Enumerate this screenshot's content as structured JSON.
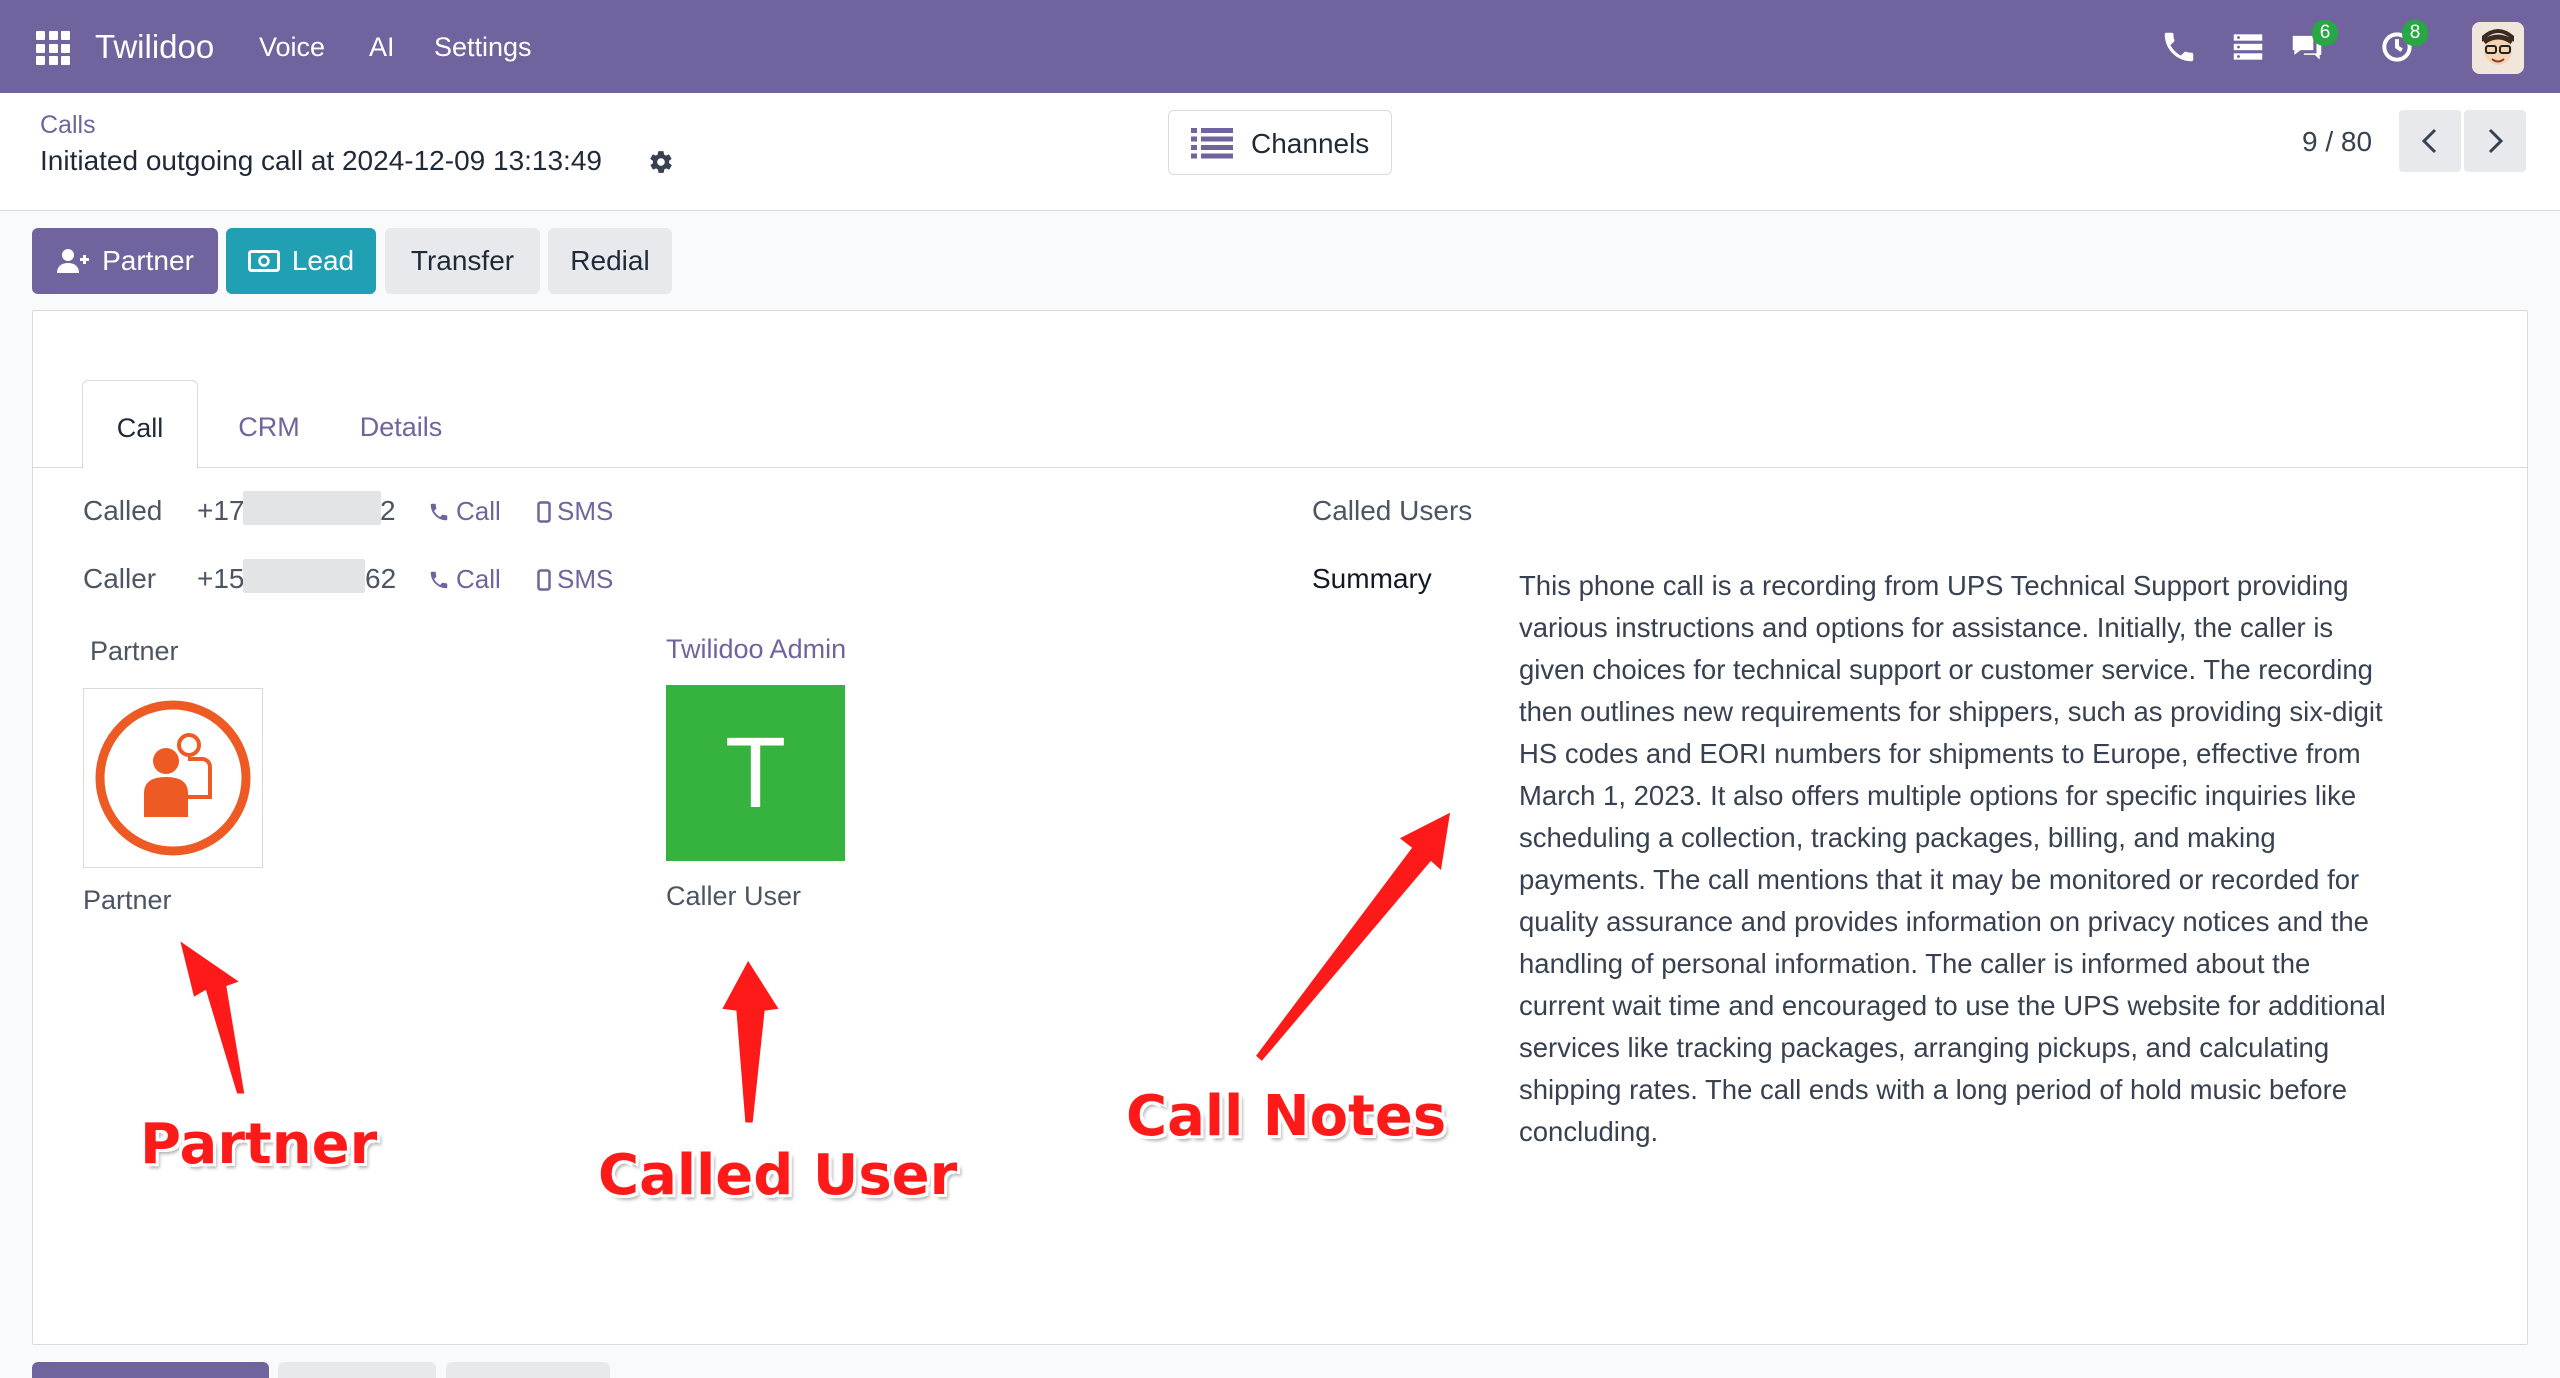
{
  "navbar": {
    "brand": "Twilidoo",
    "menu": [
      "Voice",
      "AI",
      "Settings"
    ],
    "icons": [
      "apps-icon",
      "phone-icon",
      "server-icon",
      "chat-icon",
      "activity-icon"
    ],
    "chat_badge": "6",
    "activity_badge": "8"
  },
  "control": {
    "breadcrumb": "Calls",
    "title": "Initiated outgoing call at 2024-12-09 13:13:49",
    "channels_label": "Channels",
    "pager": "9 / 80"
  },
  "actions": {
    "partner": "Partner",
    "lead": "Lead",
    "transfer": "Transfer",
    "redial": "Redial"
  },
  "tabs": [
    "Call",
    "CRM",
    "Details"
  ],
  "fields": {
    "called_label": "Called",
    "called_prefix": "+17",
    "called_suffix": "2",
    "caller_label": "Caller",
    "caller_prefix": "+15",
    "caller_suffix": "62",
    "call_link": "Call",
    "sms_link": "SMS",
    "partner_label": "Partner",
    "partner_caption": "Partner",
    "user_name": "Twilidoo Admin",
    "user_initial": "T",
    "user_caption": "Caller User",
    "called_users_label": "Called Users",
    "summary_label": "Summary",
    "summary": "This phone call is a recording from UPS Technical Support providing various instructions and options for assistance. Initially, the caller is given choices for technical support or customer service. The recording then outlines new requirements for shippers, such as providing six-digit HS codes and EORI numbers for shipments to Europe, effective from March 1, 2023. It also offers multiple options for specific inquiries like scheduling a collection, tracking packages, billing, and making payments. The call mentions that it may be monitored or recorded for quality assurance and provides information on privacy notices and the handling of personal information. The caller is informed about the current wait time and encouraged to use the UPS website for additional services like tracking packages, arranging pickups, and calculating shipping rates. The call ends with a long period of hold music before concluding."
  },
  "annotations": {
    "partner": "Partner",
    "called_user": "Called User",
    "call_notes": "Call Notes"
  },
  "colors": {
    "navbar": "#71639e",
    "primary": "#71639e",
    "lead": "#21a0b3",
    "avatar_green": "#36b33e",
    "partner_orange": "#ee5a24",
    "annotation_red": "#ff1a1a"
  }
}
